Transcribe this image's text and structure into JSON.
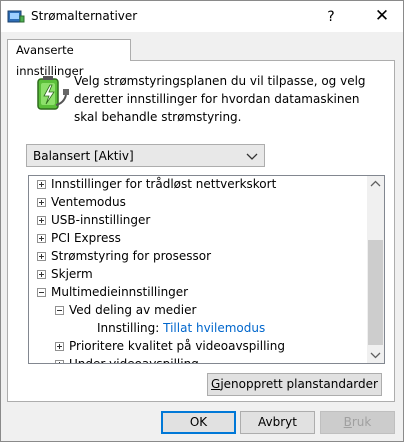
{
  "window": {
    "title": "Strømalternativer",
    "help_glyph": "?",
    "close_glyph": "✕"
  },
  "tab": {
    "label": "Avanserte innstillinger"
  },
  "description": "Velg strømstyringsplanen du vil tilpasse, og velg deretter innstillinger for hvordan datamaskinen skal behandle strømstyring.",
  "plan_select": {
    "value": "Balansert [Aktiv]"
  },
  "tree": {
    "items": [
      {
        "label": "Innstillinger for trådløst nettverkskort",
        "expander": "plus"
      },
      {
        "label": "Ventemodus",
        "expander": "plus"
      },
      {
        "label": "USB-innstillinger",
        "expander": "plus"
      },
      {
        "label": "PCI Express",
        "expander": "plus"
      },
      {
        "label": "Strømstyring for prosessor",
        "expander": "plus"
      },
      {
        "label": "Skjerm",
        "expander": "plus"
      },
      {
        "label": "Multimedieinnstillinger",
        "expander": "minus"
      },
      {
        "label": "Ved deling av medier",
        "expander": "minus"
      },
      {
        "label": "Innstilling:",
        "value": "Tillat hvilemodus"
      },
      {
        "label": "Prioritere kvalitet på videoavspilling",
        "expander": "plus"
      },
      {
        "label": "Under videoavspilling",
        "expander": "plus"
      }
    ]
  },
  "buttons": {
    "restore_prefix": "G",
    "restore_rest": "jenopprett planstandarder",
    "ok": "OK",
    "cancel": "Avbryt",
    "apply_prefix": "B",
    "apply_rest": "ruk"
  },
  "colors": {
    "link": "#0066cc",
    "battery_green": "#4caf50"
  }
}
